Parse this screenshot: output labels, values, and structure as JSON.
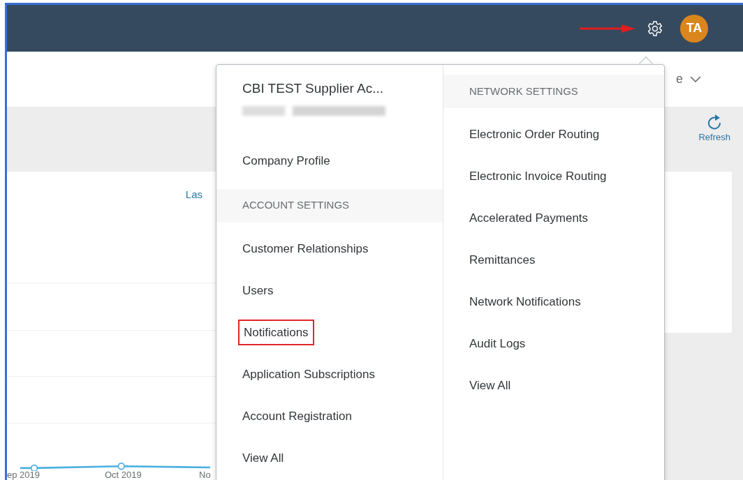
{
  "top_bar": {
    "avatar_initials": "TA"
  },
  "header": {
    "partial_text": "e"
  },
  "toolbar": {
    "refresh_label": "Refresh"
  },
  "content": {
    "partial_link": "Las",
    "chart_axis_labels": [
      "ep 2019",
      "Oct 2019",
      "No"
    ]
  },
  "settings_menu": {
    "account_name": "CBI TEST Supplier Ac...",
    "company_profile": "Company Profile",
    "account_settings": {
      "heading": "ACCOUNT SETTINGS",
      "items": [
        {
          "label": "Customer Relationships",
          "highlighted": false
        },
        {
          "label": "Users",
          "highlighted": false
        },
        {
          "label": "Notifications",
          "highlighted": true
        },
        {
          "label": "Application Subscriptions",
          "highlighted": false
        },
        {
          "label": "Account Registration",
          "highlighted": false
        },
        {
          "label": "View All",
          "highlighted": false
        }
      ]
    },
    "network_settings": {
      "heading": "NETWORK SETTINGS",
      "items": [
        {
          "label": "Electronic Order Routing",
          "highlighted": false
        },
        {
          "label": "Electronic Invoice Routing",
          "highlighted": false
        },
        {
          "label": "Accelerated Payments",
          "highlighted": false
        },
        {
          "label": "Remittances",
          "highlighted": false
        },
        {
          "label": "Network Notifications",
          "highlighted": false
        },
        {
          "label": "Audit Logs",
          "highlighted": false
        },
        {
          "label": "View All",
          "highlighted": false
        }
      ]
    }
  }
}
